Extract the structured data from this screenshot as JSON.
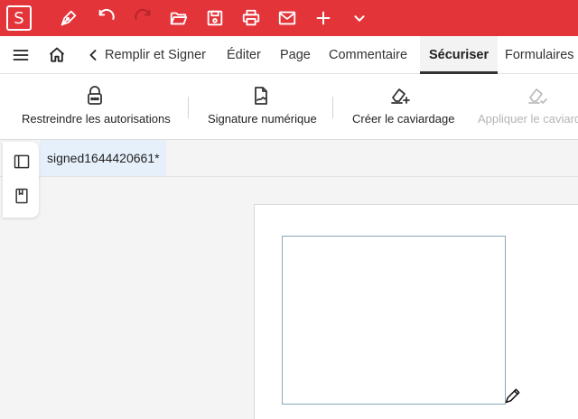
{
  "app": {
    "logo_letter": "S",
    "accent_color": "#e3343a"
  },
  "titlebar": {
    "icons": [
      "pen-nib-icon",
      "undo-icon",
      "redo-icon",
      "folder-open-icon",
      "save-icon",
      "print-icon",
      "mail-icon",
      "plus-icon",
      "chevron-down-icon"
    ]
  },
  "menubar": {
    "tabs": [
      {
        "label": "Remplir et Signer"
      },
      {
        "label": "Éditer"
      },
      {
        "label": "Page"
      },
      {
        "label": "Commentaire"
      },
      {
        "label": "Sécuriser",
        "active": true
      },
      {
        "label": "Formulaires"
      }
    ]
  },
  "ribbon": {
    "buttons": [
      {
        "label": "Restreindre les autorisations",
        "icon": "lock-icon"
      },
      {
        "label": "Signature numérique",
        "icon": "signature-file-icon"
      },
      {
        "label": "Créer le caviardage",
        "icon": "eraser-plus-icon"
      },
      {
        "label": "Appliquer le caviardage",
        "icon": "eraser-check-icon",
        "disabled": true
      }
    ]
  },
  "document": {
    "tab_name": "signed1644420661*"
  }
}
